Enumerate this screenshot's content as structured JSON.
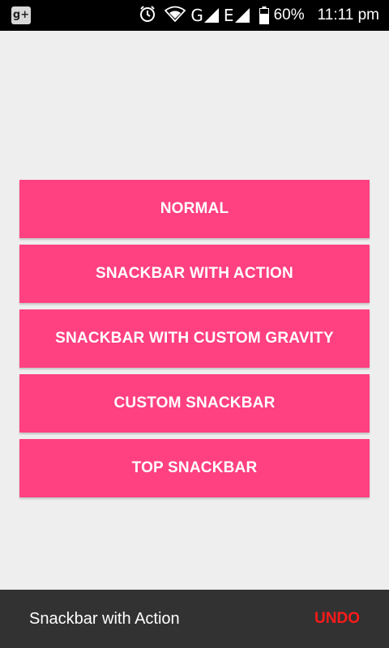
{
  "status_bar": {
    "left_icon": "google-plus-icon",
    "network_1": "G",
    "network_2": "E",
    "battery_percent": "60%",
    "time": "11:11 pm"
  },
  "buttons": [
    {
      "label": "NORMAL"
    },
    {
      "label": "SNACKBAR WITH ACTION"
    },
    {
      "label": "SNACKBAR WITH CUSTOM GRAVITY"
    },
    {
      "label": "CUSTOM SNACKBAR"
    },
    {
      "label": "TOP SNACKBAR"
    }
  ],
  "snackbar": {
    "message": "Snackbar with Action",
    "action": "UNDO"
  },
  "colors": {
    "accent": "#ff4081",
    "snackbar_bg": "#323232",
    "snackbar_action": "#ff1a1a",
    "background": "#eeeeee"
  }
}
